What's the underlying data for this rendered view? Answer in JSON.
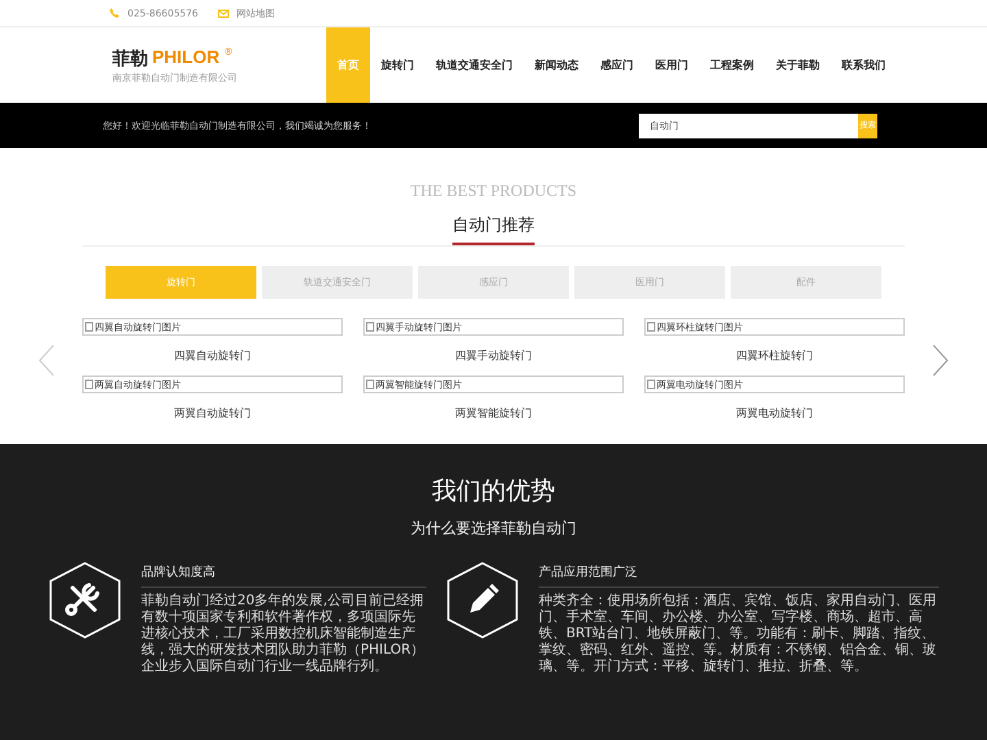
{
  "topbar": {
    "phone": "025-86605576",
    "sitemap": "网站地图"
  },
  "logo": {
    "cn": "菲勒",
    "en": "PHILOR",
    "mark": "®",
    "sub": "南京菲勒自动门制造有限公司"
  },
  "nav": [
    {
      "label": "首页",
      "selected": true
    },
    {
      "label": "旋转门",
      "selected": false
    },
    {
      "label": "轨道交通安全门",
      "selected": false
    },
    {
      "label": "新闻动态",
      "selected": false
    },
    {
      "label": "感应门",
      "selected": false
    },
    {
      "label": "医用门",
      "selected": false
    },
    {
      "label": "工程案例",
      "selected": false
    },
    {
      "label": "关于菲勒",
      "selected": false
    },
    {
      "label": "联系我们",
      "selected": false
    }
  ],
  "welcome": "您好！欢迎光临菲勒自动门制造有限公司，我们竭诚为您服务！",
  "search": {
    "value": "自动门",
    "button": "搜索"
  },
  "products": {
    "eyebrow": "THE BEST PRODUCTS",
    "title": "自动门推荐",
    "tabs": [
      {
        "label": "旋转门",
        "selected": true
      },
      {
        "label": "轨道交通安全门",
        "selected": false
      },
      {
        "label": "感应门",
        "selected": false
      },
      {
        "label": "医用门",
        "selected": false
      },
      {
        "label": "配件",
        "selected": false
      }
    ],
    "items": [
      {
        "alt": "四翼自动旋转门图片",
        "name": "四翼自动旋转门"
      },
      {
        "alt": "四翼手动旋转门图片",
        "name": "四翼手动旋转门"
      },
      {
        "alt": "四翼环柱旋转门图片",
        "name": "四翼环柱旋转门"
      },
      {
        "alt": "两翼自动旋转门图片",
        "name": "两翼自动旋转门"
      },
      {
        "alt": "两翼智能旋转门图片",
        "name": "两翼智能旋转门"
      },
      {
        "alt": "两翼电动旋转门图片",
        "name": "两翼电动旋转门"
      }
    ]
  },
  "advantages": {
    "title": "我们的优势",
    "subtitle": "为什么要选择菲勒自动门",
    "items": [
      {
        "kind": "tools",
        "title": "品牌认知度高",
        "text": "菲勒自动门经过20多年的发展,公司目前已经拥有数十项国家专利和软件著作权，多项国际先进核心技术，工厂采用数控机床智能制造生产线，强大的研发技术团队助力菲勒（PHILOR）企业步入国际自动门行业一线品牌行列。"
      },
      {
        "kind": "pencil",
        "title": "产品应用范围广泛",
        "text": "种类齐全：使用场所包括：酒店、宾馆、饭店、家用自动门、医用门、手术室、车间、办公楼、办公室、写字楼、商场、超市、高铁、BRT站台门、地铁屏蔽门、等。功能有：刷卡、脚踏、指纹、掌纹、密码、红外、遥控、等。材质有：不锈钢、铝合金、铜、玻璃、等。开门方式：平移、旋转门、推拉、折叠、等。"
      }
    ]
  }
}
